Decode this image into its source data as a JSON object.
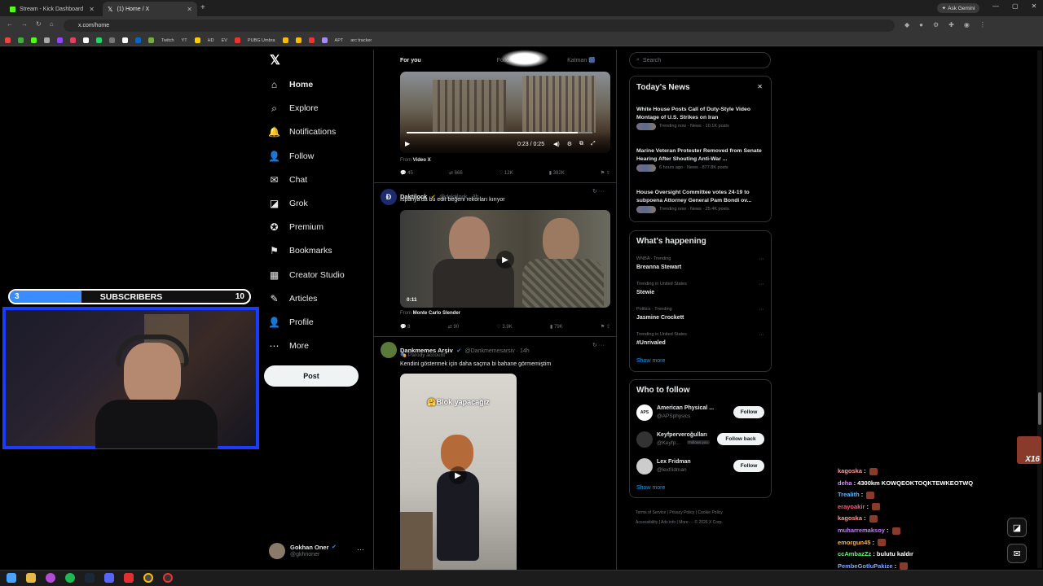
{
  "browser": {
    "tabs": [
      {
        "title": "Stream - Kick Dashboard"
      },
      {
        "title": "(1) Home / X"
      }
    ],
    "url": "x.com/home",
    "ask_gemini": "Ask Gemini",
    "bookmarks": [
      "Twitch",
      "YT",
      "HD",
      "EV",
      "PUBG Umbra",
      "APT",
      "arc tracker"
    ]
  },
  "overlay": {
    "subscribers_current": "3",
    "subscribers_label": "SUBSCRIBERS",
    "subscribers_goal": "10",
    "subscribers_progress": 0.3
  },
  "x": {
    "logo": "𝕏",
    "nav": [
      {
        "label": "Home",
        "icon": "home-icon",
        "glyph": "⌂"
      },
      {
        "label": "Explore",
        "icon": "search-icon",
        "glyph": "⌕"
      },
      {
        "label": "Notifications",
        "icon": "bell-icon",
        "glyph": "🔔"
      },
      {
        "label": "Follow",
        "icon": "person-add-icon",
        "glyph": "👤"
      },
      {
        "label": "Chat",
        "icon": "mail-icon",
        "glyph": "✉"
      },
      {
        "label": "Grok",
        "icon": "grok-icon",
        "glyph": "◪"
      },
      {
        "label": "Premium",
        "icon": "premium-icon",
        "glyph": "✪"
      },
      {
        "label": "Bookmarks",
        "icon": "bookmark-icon",
        "glyph": "⚑"
      },
      {
        "label": "Creator Studio",
        "icon": "studio-icon",
        "glyph": "▦"
      },
      {
        "label": "Articles",
        "icon": "articles-icon",
        "glyph": "✎"
      },
      {
        "label": "Profile",
        "icon": "profile-icon",
        "glyph": "👤"
      },
      {
        "label": "More",
        "icon": "more-icon",
        "glyph": "⋯"
      }
    ],
    "post_button": "Post",
    "account": {
      "name": "Gokhan Oner",
      "handle": "@gkhnoner"
    },
    "feed_tabs": [
      "For you",
      "Following",
      "Katman 🎆"
    ],
    "tweet0": {
      "time": "0:23 / 0:25",
      "from_prefix": "From",
      "from_name": "Video X",
      "replies": "45",
      "reposts": "666",
      "likes": "12K",
      "views": "392K"
    },
    "tweet1": {
      "name": "Daktilock",
      "handle": "@daktilock · 3h",
      "text": "İspanya'da bu edit beğeni rekorları kırıyor",
      "duration": "0:11",
      "from_prefix": "From",
      "from_name": "Monte Carlo Slender",
      "replies": "8",
      "reposts": "90",
      "likes": "3.9K",
      "views": "79K"
    },
    "tweet2": {
      "name": "Dankmemes Arşiv",
      "handle": "@Dankmemesarsiv · 14h",
      "parody": "Parody account",
      "text": "Kendini göstermek için daha saçma bi bahane görmemiştim",
      "overlay_text": "🤗Blok yapacağız"
    },
    "search_placeholder": "Search",
    "news": {
      "title": "Today's News",
      "items": [
        {
          "title": "White House Posts Call of Duty-Style Video Montage of U.S. Strikes on Iran",
          "meta": "Trending now · News · 10.1K posts"
        },
        {
          "title": "Marine Veteran Protester Removed from Senate Hearing After Shouting Anti-War ...",
          "meta": "6 hours ago · News · 877.8K posts"
        },
        {
          "title": "House Oversight Committee votes 24-19 to subpoena Attorney General Pam Bondi ov...",
          "meta": "Trending now · News · 25.4K posts"
        }
      ]
    },
    "happening": {
      "title": "What's happening",
      "items": [
        {
          "cat": "WNBA · Trending",
          "name": "Breanna Stewart"
        },
        {
          "cat": "Trending in United States",
          "name": "Stewie"
        },
        {
          "cat": "Politics · Trending",
          "name": "Jasmine Crockett"
        },
        {
          "cat": "Trending in United States",
          "name": "#Unrivaled"
        }
      ],
      "show_more": "Show more"
    },
    "who": {
      "title": "Who to follow",
      "items": [
        {
          "name": "American Physical ...",
          "handle": "@APSphysics",
          "btn": "Follow",
          "avatar": "APS"
        },
        {
          "name": "Keyfperveroğulları",
          "handle": "@Keyfp...",
          "extra": "Follows you",
          "btn": "Follow back",
          "avatar": ""
        },
        {
          "name": "Lex Fridman",
          "handle": "@lexfridman",
          "btn": "Follow",
          "avatar": ""
        }
      ],
      "show_more": "Show more"
    },
    "footer": [
      "Terms of Service",
      "Privacy Policy",
      "Cookie Policy",
      "Accessibility",
      "Ads info",
      "More ···",
      "© 2026 X Corp."
    ]
  },
  "chat": {
    "badge": "X16",
    "messages": [
      {
        "user": "kagoska",
        "text": " : ",
        "color": "#ff9a9a"
      },
      {
        "user": "deha",
        "text": " : 4300km KOWQEOKTOQKTEWKEOTWQ",
        "color": "#d98cff"
      },
      {
        "user": "Trealith",
        "text": " : ",
        "color": "#5cb8ff"
      },
      {
        "user": "erayoakir",
        "text": " : ",
        "color": "#ff5c7a"
      },
      {
        "user": "kagoska",
        "text": " : ",
        "color": "#ff9a9a"
      },
      {
        "user": "muharremaksoy",
        "text": " : ",
        "color": "#c77dff"
      },
      {
        "user": "emorgun45",
        "text": " : ",
        "color": "#ffb347"
      },
      {
        "user": "ccAmbazZz",
        "text": " : bulutu kaldır",
        "color": "#5cff6a"
      },
      {
        "user": "PembeGotluPakize",
        "text": " : ",
        "color": "#7fa8ff"
      },
      {
        "user": "kagoska",
        "text": " : ",
        "color": "#ff9a9a"
      }
    ]
  },
  "colors": {
    "x_blue": "#1d9bf0",
    "border": "#2f3336",
    "muted": "#71767b",
    "overlay_blue": "#1a3cff"
  }
}
